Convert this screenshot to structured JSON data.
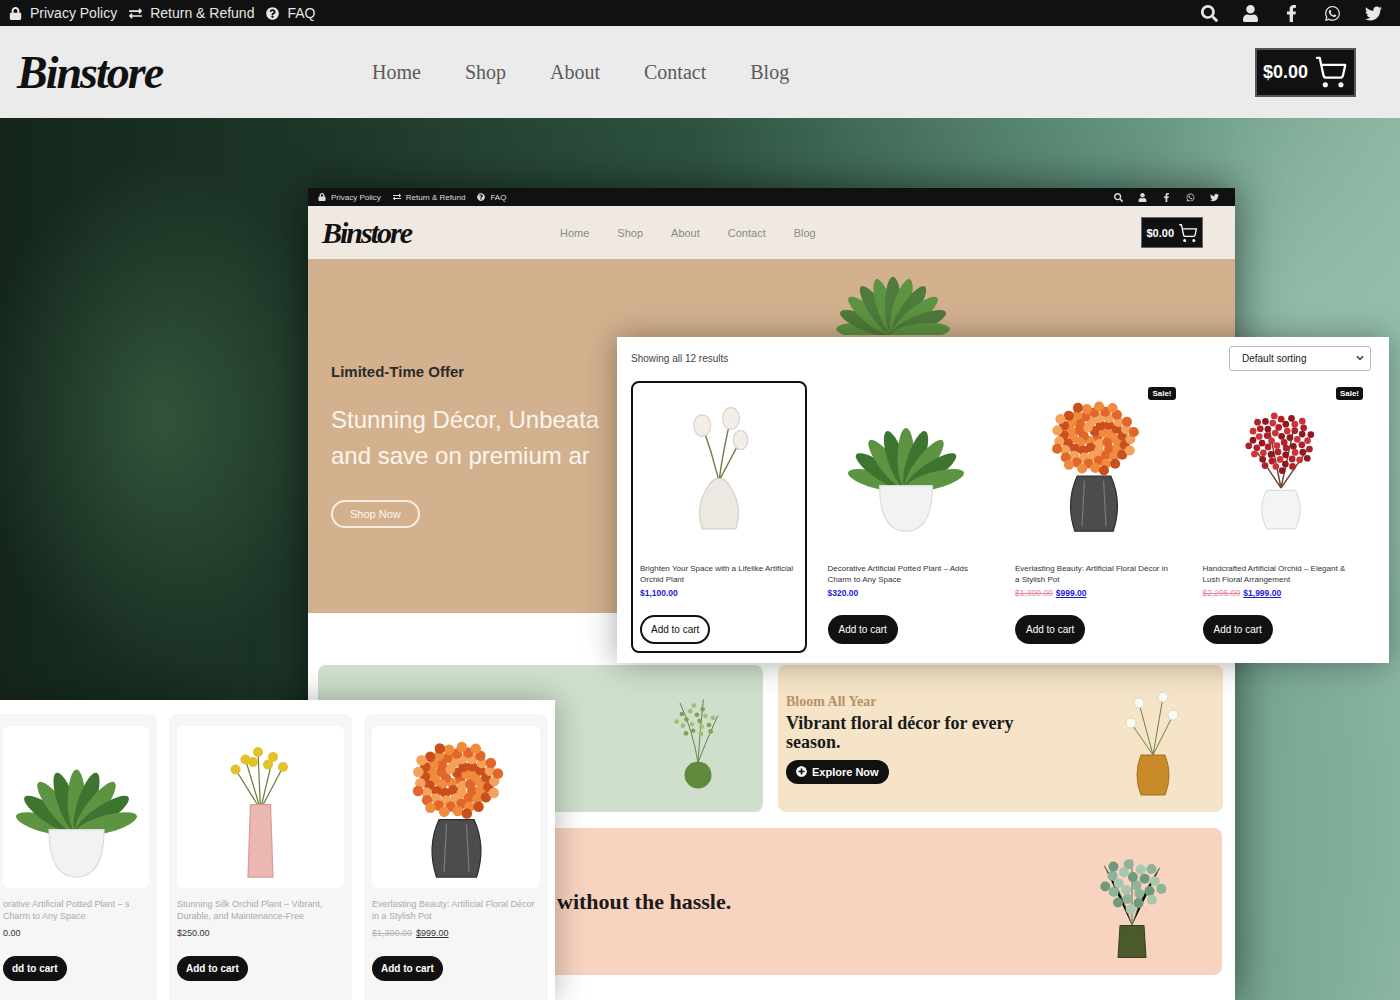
{
  "site": {
    "topbar_links": [
      "Privacy Policy",
      "Return & Refund",
      "FAQ"
    ],
    "logo": "Binstore",
    "nav": [
      "Home",
      "Shop",
      "About",
      "Contact",
      "Blog"
    ],
    "cart": "$0.00"
  },
  "preview": {
    "topbar_links": [
      "Privacy Policy",
      "Return & Refund",
      "FAQ"
    ],
    "logo": "Binstore",
    "nav": [
      "Home",
      "Shop",
      "About",
      "Contact",
      "Blog"
    ],
    "cart": "$0.00",
    "hero": {
      "eyebrow": "Limited-Time Offer",
      "headline": [
        "Stunning Décor, Unbeata",
        "and save on premium ar"
      ],
      "button": "Shop Now"
    },
    "promo": {
      "eyebrow": "Bloom All Year",
      "title": "Vibrant floral décor for every season.",
      "button": "Explore Now"
    },
    "banner": "without the hassle."
  },
  "shop_grid": {
    "results": "Showing all 12 results",
    "sorting": "Default sorting",
    "products": [
      {
        "title": "Brighten Your Space with a Lifelike Artificial Orchid Plant",
        "price": "$1,100.00",
        "button": "Add to cart",
        "selected": true
      },
      {
        "title": "Decorative Artificial Potted Plant – Adds Charm to Any Space",
        "price": "$320.00",
        "button": "Add to cart",
        "selected": false
      },
      {
        "title": "Everlasting Beauty: Artificial Floral Décor in a Stylish Pot",
        "old_price": "$1,300.00",
        "price": "$999.00",
        "badge": "Sale!",
        "button": "Add to cart",
        "selected": false
      },
      {
        "title": "Handcrafted Artificial Orchid – Elegant & Lush Floral Arrangement",
        "old_price": "$2,295.00",
        "price": "$1,999.00",
        "badge": "Sale!",
        "button": "Add to cart",
        "selected": false
      }
    ]
  },
  "related": {
    "products": [
      {
        "title": "orative Artificial Potted Plant – s Charm to Any Space",
        "price": "0.00",
        "button": "dd to cart"
      },
      {
        "title": "Stunning Silk Orchid Plant – Vibrant, Durable, and Maintenance-Free",
        "price": "$250.00",
        "button": "Add to cart"
      },
      {
        "title": "Everlasting Beauty: Artificial Floral Décor in a Stylish Pot",
        "old_price": "$1,300.00",
        "price": "$999.00",
        "button": "Add to cart"
      }
    ]
  }
}
